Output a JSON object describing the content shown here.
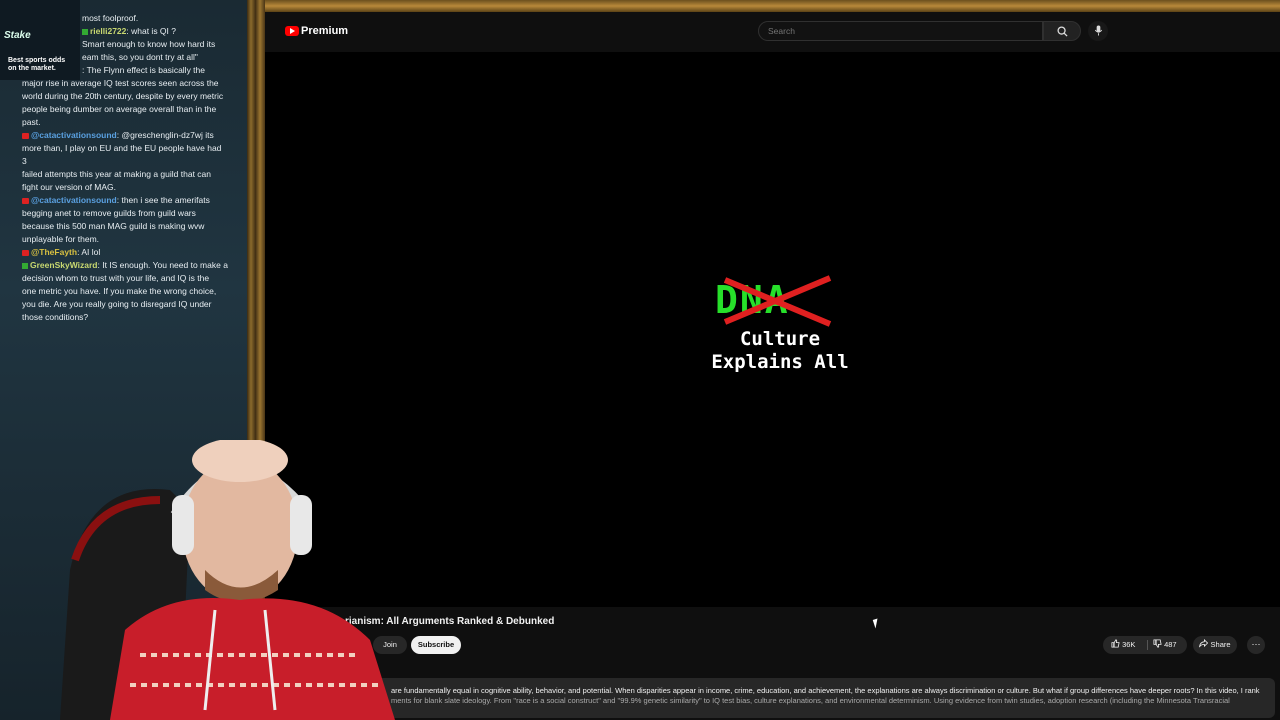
{
  "chat": {
    "ad": {
      "logo_text": "Stake",
      "line1": "Best sports odds",
      "line2": "on the market."
    },
    "messages": [
      {
        "user": "",
        "text": "most foolproof."
      },
      {
        "user": "rielli2722",
        "text": ": what is QI ?"
      },
      {
        "user": "",
        "text": "Smart enough to know how hard its"
      },
      {
        "user": "",
        "text": "eam this, so you dont try at all\""
      },
      {
        "user": "",
        "text": ": The Flynn effect is basically the"
      },
      {
        "user": "",
        "text": "major rise in average IQ test scores seen across the"
      },
      {
        "user": "",
        "text": "world during the 20th century, despite by every metric"
      },
      {
        "user": "",
        "text": "people being dumber on average overall than in the"
      },
      {
        "user": "",
        "text": "past."
      },
      {
        "user": "@catactivationsound",
        "text": ": @greschenglin-dz7wj its"
      },
      {
        "user": "",
        "text": "more than, I play on EU and the EU people have had 3"
      },
      {
        "user": "",
        "text": "failed attempts this year at making a guild that can"
      },
      {
        "user": "",
        "text": "fight our version of MAG."
      },
      {
        "user": "@catactivationsound",
        "text": ": then i see the amerifats"
      },
      {
        "user": "",
        "text": "begging anet to remove guilds from guild wars"
      },
      {
        "user": "",
        "text": "because this 500 man MAG guild is making wvw"
      },
      {
        "user": "",
        "text": "unplayable for them."
      },
      {
        "user": "@TheFayth",
        "text": ": AI lol"
      },
      {
        "user": "GreenSkyWizard",
        "text": ": It IS enough. You need to make a"
      },
      {
        "user": "",
        "text": "decision whom to trust with your life, and IQ is the"
      },
      {
        "user": "",
        "text": "one metric you have. If you make the wrong choice,"
      },
      {
        "user": "",
        "text": "you die. Are you really going to disregard IQ under"
      },
      {
        "user": "",
        "text": "those conditions?"
      }
    ]
  },
  "youtube": {
    "brand": "Premium",
    "search_placeholder": "Search",
    "video": {
      "thumbnail_crossed_text": "DNA",
      "thumbnail_line1": "Culture",
      "thumbnail_line2": "Explains All",
      "title": "rianism: All Arguments Ranked & Debunked",
      "join_label": "Join",
      "subscribe_label": "Subscribe",
      "likes": "36K",
      "dislikes": "487",
      "share_label": "Share",
      "description_line1": "are fundamentally equal in cognitive ability, behavior, and potential. When disparities appear in income, crime, education, and achievement, the explanations are always discrimination or culture. But what if group differences have deeper roots? In this video, I rank",
      "description_line2": "ments for blank slate ideology. From \"race is a social construct\" and \"99.9% genetic similarity\" to IQ test bias, culture explanations, and environmental determinism. Using evidence from twin studies, adoption research (including the Minnesota Transracial"
    }
  },
  "colors": {
    "accent_green": "#27e02a",
    "cross_red": "#e02020",
    "yt_red": "#ff0000"
  },
  "icons": [
    "youtube-logo-icon",
    "search-icon",
    "mic-icon",
    "thumbs-up-icon",
    "thumbs-down-icon",
    "share-icon",
    "more-icon",
    "mouse-cursor-icon"
  ]
}
